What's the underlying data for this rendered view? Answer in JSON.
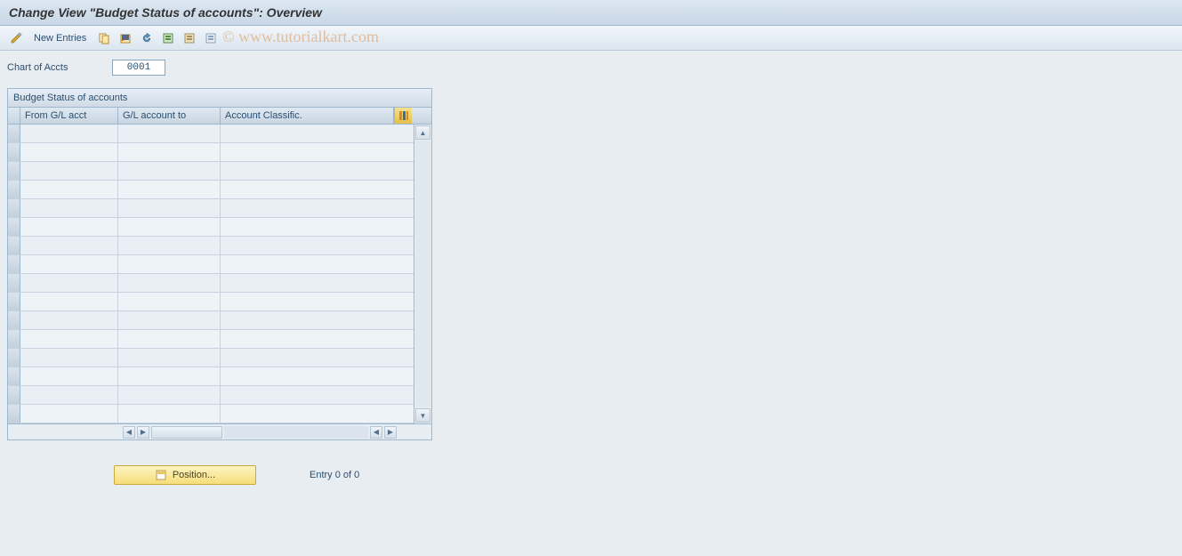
{
  "title": "Change View \"Budget Status of accounts\": Overview",
  "toolbar": {
    "new_entries_label": "New Entries"
  },
  "watermark": "© www.tutorialkart.com",
  "fields": {
    "chart_of_accts_label": "Chart of Accts",
    "chart_of_accts_value": "0001"
  },
  "grid": {
    "title": "Budget Status of accounts",
    "columns": {
      "from_gl": "From G/L acct",
      "gl_to": "G/L account to",
      "classific": "Account Classific."
    },
    "row_count": 16
  },
  "footer": {
    "position_label": "Position...",
    "entry_text": "Entry 0 of 0"
  }
}
